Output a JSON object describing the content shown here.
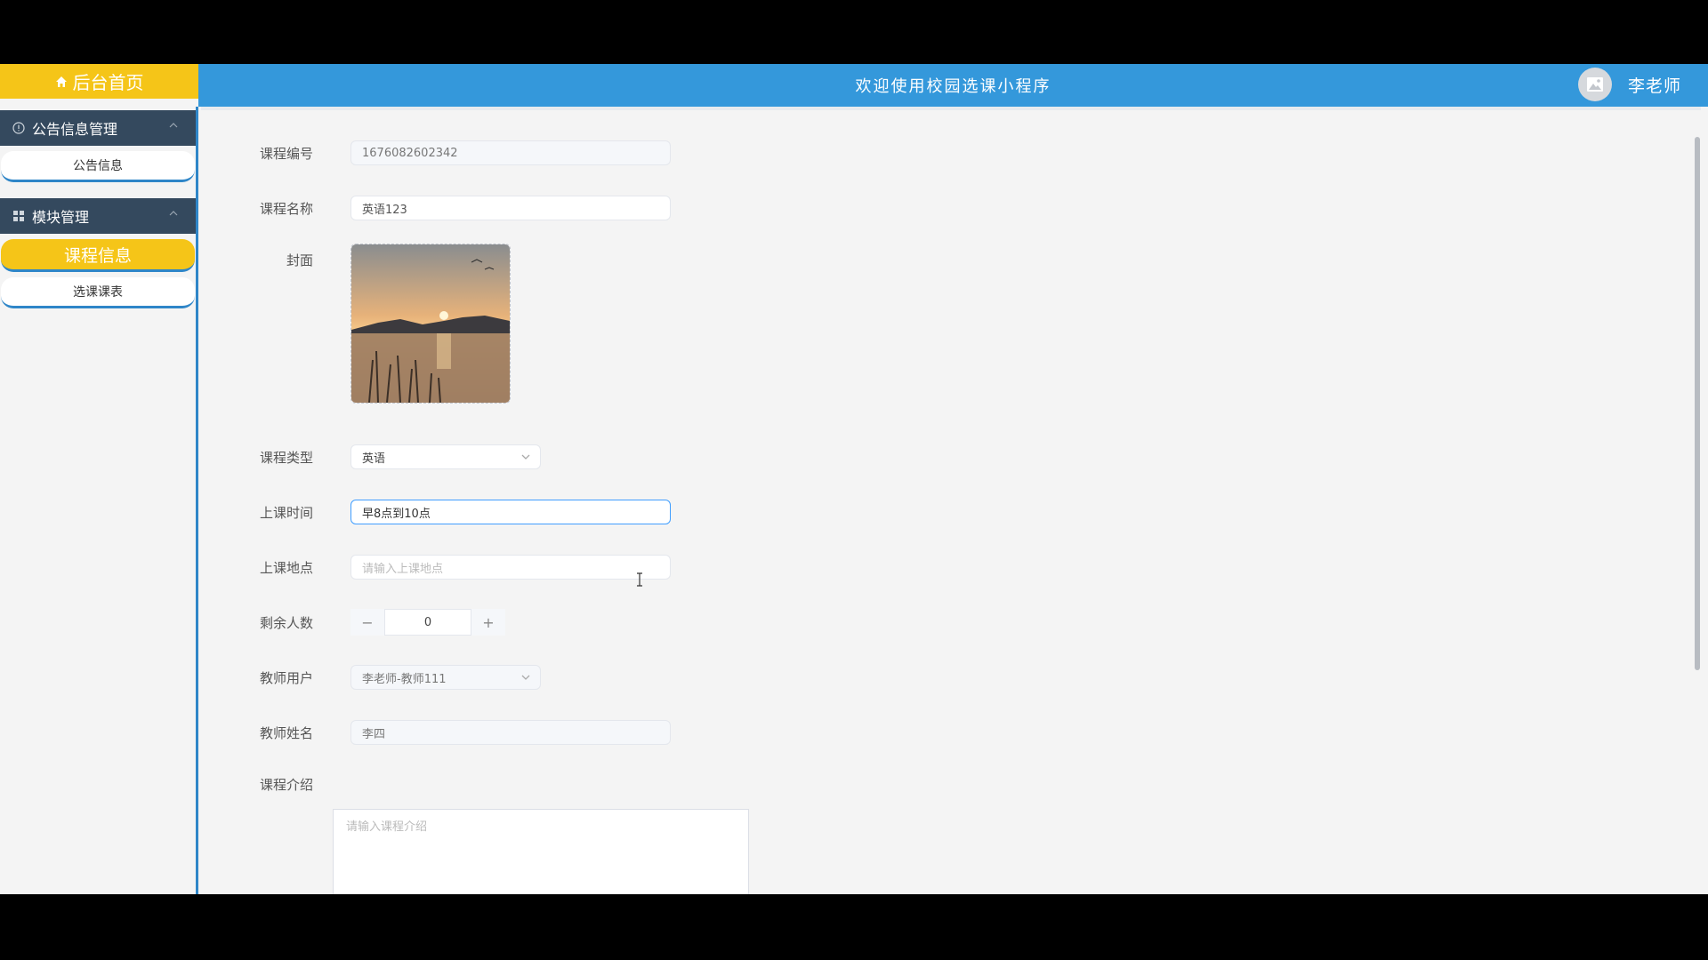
{
  "header": {
    "home_label": "后台首页",
    "title": "欢迎使用校园选课小程序",
    "user_name": "李老师"
  },
  "sidebar": {
    "sections": [
      {
        "label": "公告信息管理",
        "items": [
          "公告信息"
        ]
      },
      {
        "label": "模块管理",
        "items": [
          "课程信息",
          "选课课表"
        ]
      }
    ],
    "active_item": "课程信息"
  },
  "form": {
    "course_no": {
      "label": "课程编号",
      "value": "1676082602342"
    },
    "course_name": {
      "label": "课程名称",
      "value": "英语123"
    },
    "cover": {
      "label": "封面"
    },
    "course_type": {
      "label": "课程类型",
      "value": "英语"
    },
    "class_time": {
      "label": "上课时间",
      "value": "早8点到10点"
    },
    "location": {
      "label": "上课地点",
      "placeholder": "请输入上课地点"
    },
    "remaining": {
      "label": "剩余人数",
      "value": "0",
      "minus": "−",
      "plus": "+"
    },
    "teacher_user": {
      "label": "教师用户",
      "value": "李老师-教师111"
    },
    "teacher_name": {
      "label": "教师姓名",
      "value": "李四"
    },
    "intro": {
      "label": "课程介绍",
      "placeholder": "请输入课程介绍"
    }
  },
  "colors": {
    "accent_yellow": "#f5c518",
    "header_blue": "#3498db",
    "sidebar_dark": "#34495e"
  }
}
